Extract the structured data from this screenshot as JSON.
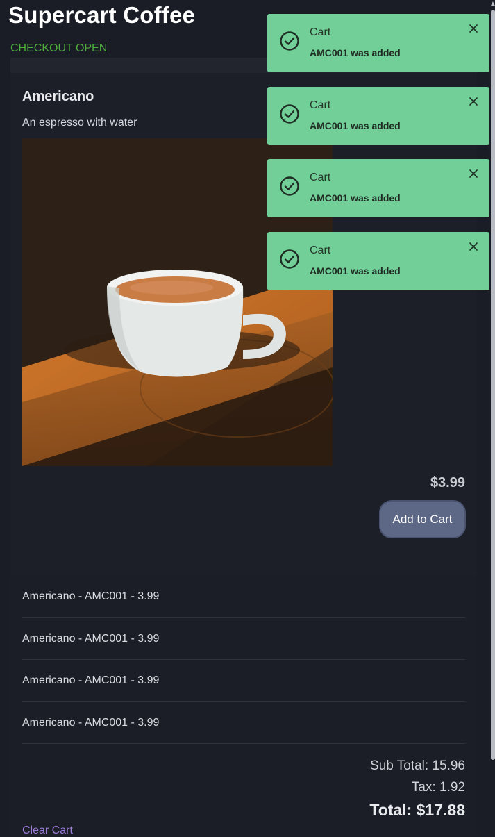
{
  "header": {
    "title": "Supercart Coffee",
    "checkout_status": "CHECKOUT OPEN",
    "status_color": "#4fae3d"
  },
  "product": {
    "name": "Americano",
    "description": "An espresso with water",
    "price": "$3.99",
    "add_button_label": "Add to Cart",
    "image_icon": "coffee-cup-photo"
  },
  "cart": {
    "items": [
      {
        "label": "Americano - AMC001 - 3.99"
      },
      {
        "label": "Americano - AMC001 - 3.99"
      },
      {
        "label": "Americano - AMC001 - 3.99"
      },
      {
        "label": "Americano - AMC001 - 3.99"
      }
    ],
    "subtotal": "Sub Total: 15.96",
    "tax": "Tax: 1.92",
    "total": "Total: $17.88",
    "clear_label": "Clear Cart"
  },
  "toasts": [
    {
      "title": "Cart",
      "message": "AMC001 was added",
      "icon": "check-circle-icon"
    },
    {
      "title": "Cart",
      "message": "AMC001 was added",
      "icon": "check-circle-icon"
    },
    {
      "title": "Cart",
      "message": "AMC001 was added",
      "icon": "check-circle-icon"
    },
    {
      "title": "Cart",
      "message": "AMC001 was added",
      "icon": "check-circle-icon"
    }
  ],
  "colors": {
    "background": "#1a1d25",
    "toast": "#71cf97",
    "button": "#5d6886",
    "link": "#9b7bd8"
  }
}
